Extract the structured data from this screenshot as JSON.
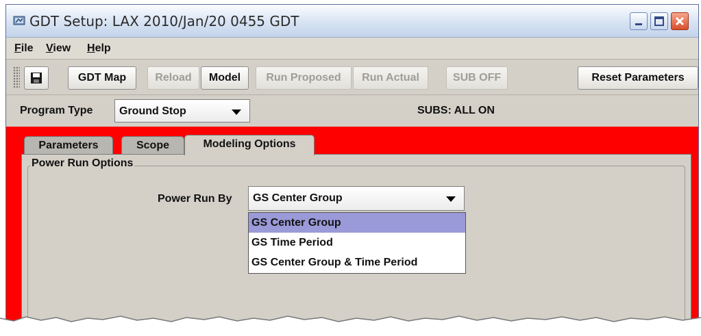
{
  "window": {
    "title": "GDT Setup: LAX 2010/Jan/20 0455 GDT"
  },
  "menu": [
    {
      "mnemonic": "F",
      "rest": "ile"
    },
    {
      "mnemonic": "V",
      "rest": "iew"
    },
    {
      "mnemonic": "H",
      "rest": "elp"
    }
  ],
  "toolbar": {
    "gdt_map": "GDT Map",
    "reload": "Reload",
    "model": "Model",
    "run_proposed": "Run Proposed",
    "run_actual": "Run Actual",
    "sub_off": "SUB OFF",
    "reset_parameters": "Reset Parameters"
  },
  "program": {
    "label": "Program Type",
    "value": "Ground Stop",
    "subs_status": "SUBS: ALL ON"
  },
  "tabs": [
    "Parameters",
    "Scope",
    "Modeling Options"
  ],
  "active_tab": "Modeling Options",
  "power_run": {
    "group_title": "Power Run Options",
    "label": "Power Run By",
    "value": "GS Center Group",
    "options": [
      "GS Center Group",
      "GS Time Period",
      "GS Center Group & Time Period"
    ],
    "highlighted_option": "GS Center Group"
  },
  "colors": {
    "status_panel": "#ff0000",
    "selection": "#9a9ad8",
    "panel_bg": "#d4d0c8"
  },
  "icons": [
    "app-icon",
    "save-icon",
    "minimize-icon",
    "maximize-icon",
    "close-icon",
    "chevron-down-icon"
  ]
}
